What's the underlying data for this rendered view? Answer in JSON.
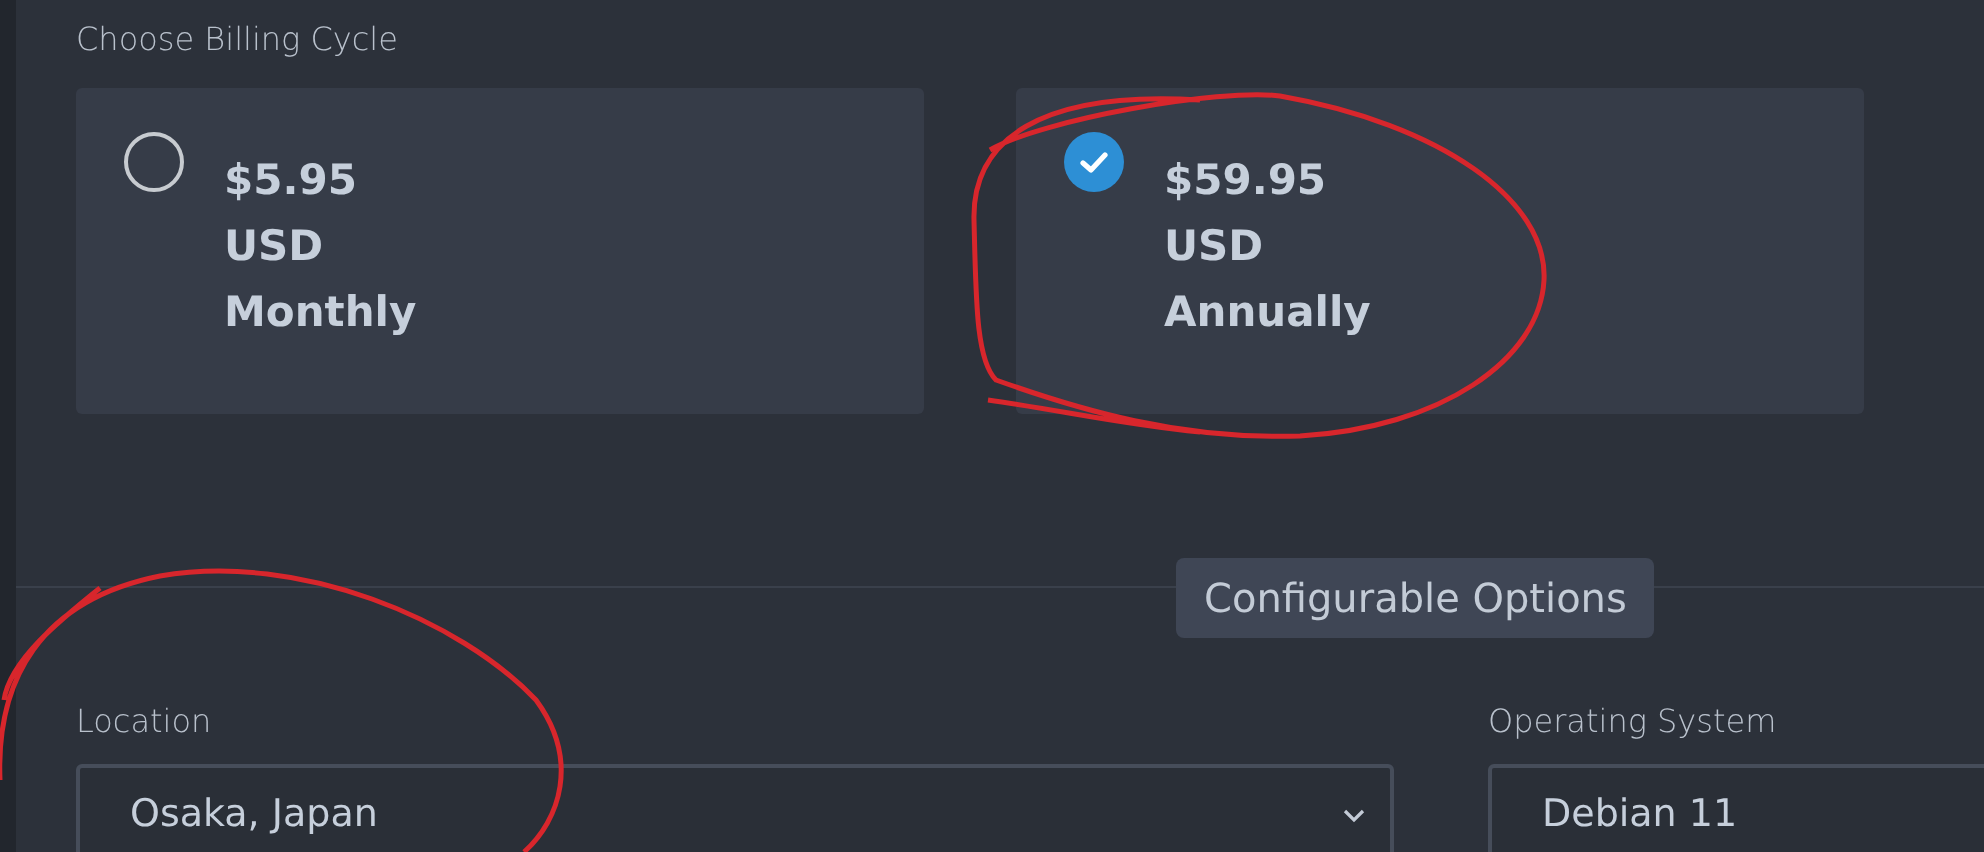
{
  "billing": {
    "title": "Choose Billing Cycle",
    "cycles": [
      {
        "price": "$5.95",
        "currency": "USD",
        "period": "Monthly",
        "selected": false
      },
      {
        "price": "$59.95",
        "currency": "USD",
        "period": "Annually",
        "selected": true
      }
    ]
  },
  "section_badge": "Configurable Options",
  "fields": [
    {
      "label": "Location",
      "value": "Osaka, Japan"
    },
    {
      "label": "Operating System",
      "value": "Debian 11"
    }
  ]
}
